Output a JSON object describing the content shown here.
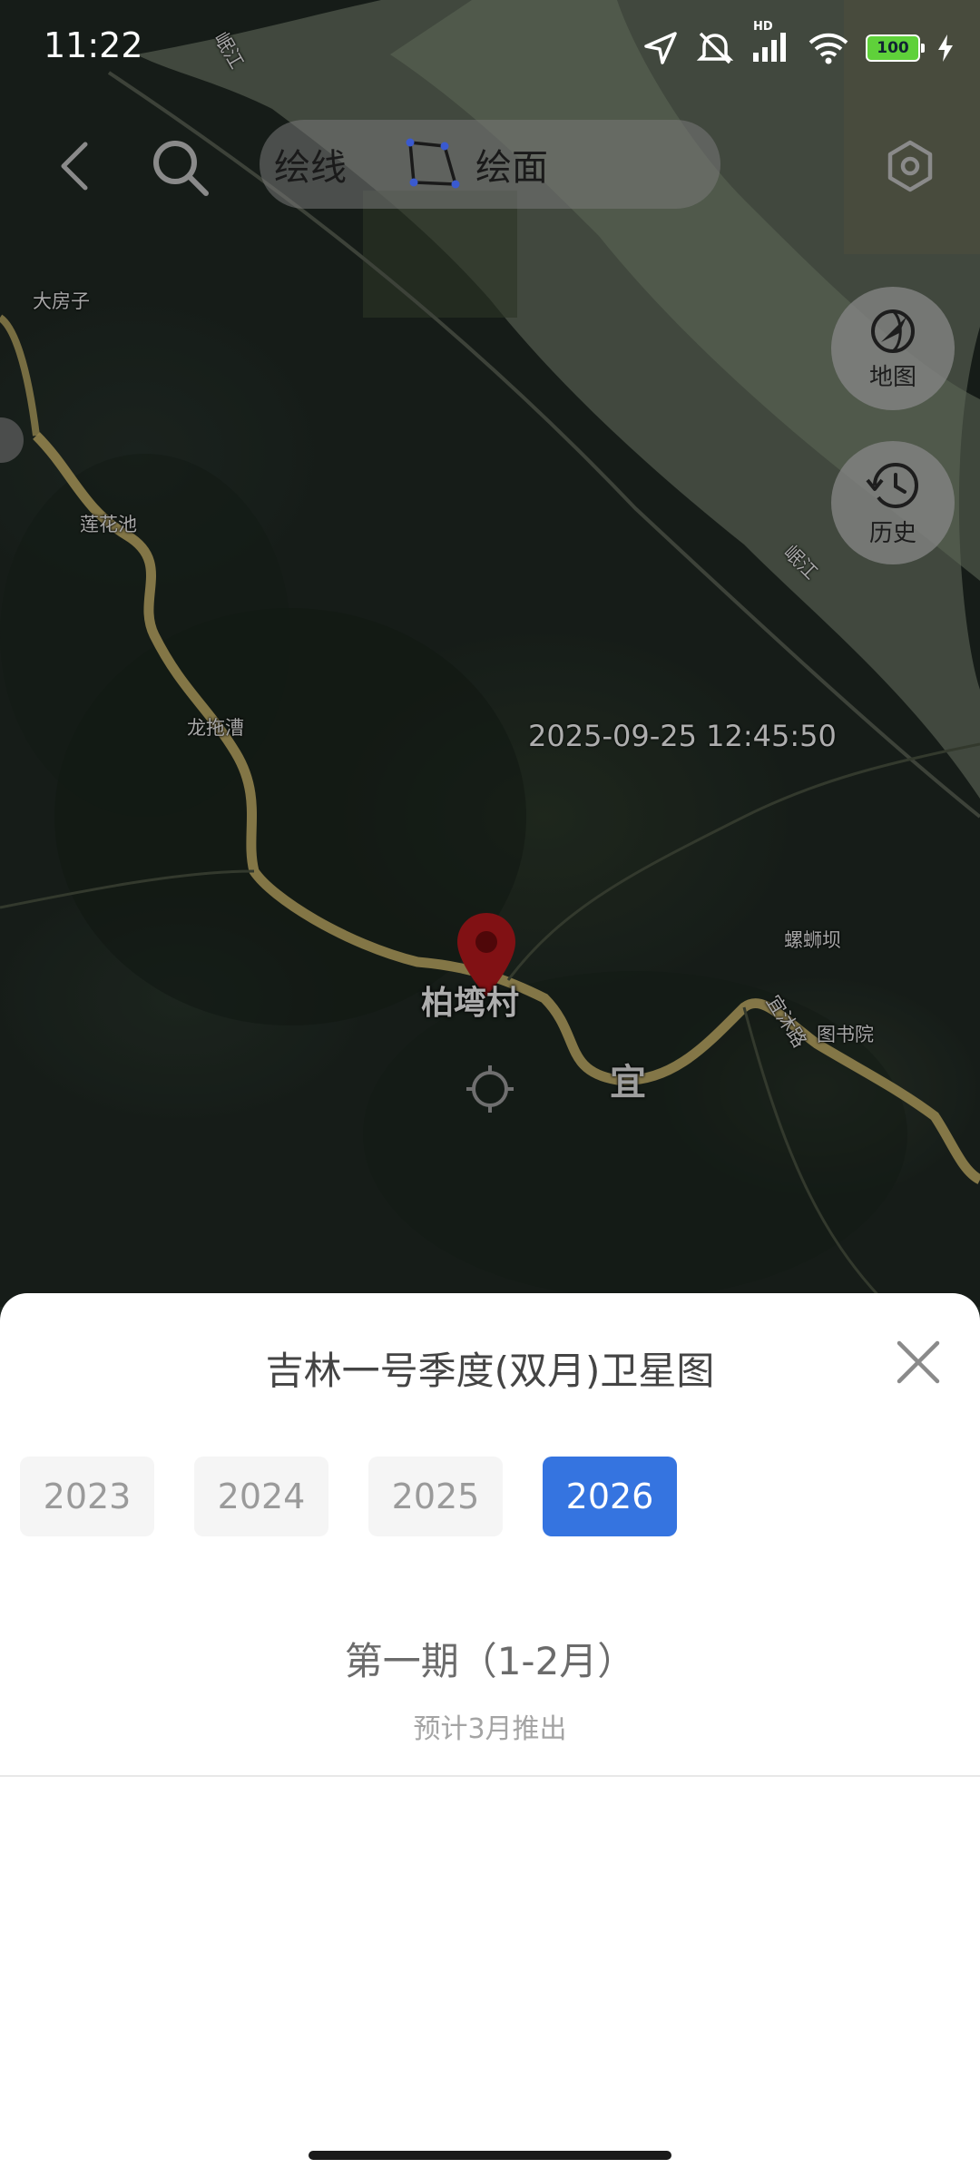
{
  "status_bar": {
    "time": "11:22",
    "battery": "100",
    "network_badge": "HD",
    "icons": [
      "location-arrow-icon",
      "mute-icon",
      "signal-icon",
      "wifi-icon",
      "battery-icon",
      "charging-icon"
    ]
  },
  "toolbar": {
    "back_icon": "chevron-left-icon",
    "search_icon": "search-icon",
    "draw_line_label": "绘线",
    "draw_area_label": "绘面",
    "settings_icon": "hexagon-settings-icon"
  },
  "map_controls": {
    "map_label": "地图",
    "history_label": "历史"
  },
  "map": {
    "timestamp": "2025-09-25 12:45:50",
    "selected_place": "柏塆村",
    "labels": {
      "dafangzi": "大房子",
      "lianhuachi": "莲花池",
      "longtuocao": "龙拖漕",
      "minjiang_top": "岷江",
      "minjiang_right": "岷江",
      "luoshiba": "螺蛳坝",
      "tushuyuan": "图书院",
      "road": "宜沐路",
      "road_partial": "宜"
    }
  },
  "sheet": {
    "title": "吉林一号季度(双月)卫星图",
    "years": [
      "2023",
      "2024",
      "2025",
      "2026"
    ],
    "selected_year": "2026",
    "period_title": "第一期（1-2月）",
    "period_note": "预计3月推出"
  },
  "colors": {
    "accent": "#3574e0",
    "pin": "#b3181c",
    "road": "#c8b36a",
    "river": "#8f9a84"
  }
}
